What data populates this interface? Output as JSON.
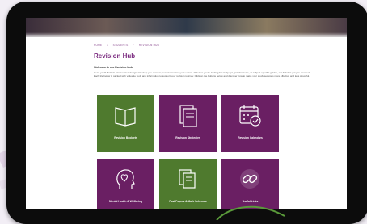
{
  "breadcrumb": [
    "HOME",
    "STUDENTS",
    "REVISION HUB"
  ],
  "page_title": "Revision Hub",
  "intro_heading": "Welcome to our Revision Hub",
  "intro_text": "Here, you'll find lots of resources designed to help you excel in your studies and your exams. Whether you're looking for study tips, practice tests, or subject-specific guides, our hub has got you covered. Each tile below is packed with valuable tools and information to support your revision journey. Click on the buttons below and discover how to make your study sessions more effective and less stressful.",
  "tiles": [
    {
      "label": "Revision Booklets",
      "icon": "booklet-icon",
      "color": "#4f7a2e"
    },
    {
      "label": "Revision Strategies",
      "icon": "strategy-icon",
      "color": "#6a1f63"
    },
    {
      "label": "Revision Calendars",
      "icon": "calendar-icon",
      "color": "#6a1f63"
    },
    {
      "label": "Mental Health & Wellbeing",
      "icon": "heart-head-icon",
      "color": "#6a1f63"
    },
    {
      "label": "Past Papers & Mark Schemes",
      "icon": "papers-icon",
      "color": "#4f7a2e"
    },
    {
      "label": "Useful Links",
      "icon": "link-icon",
      "color": "#6a1f63"
    }
  ]
}
